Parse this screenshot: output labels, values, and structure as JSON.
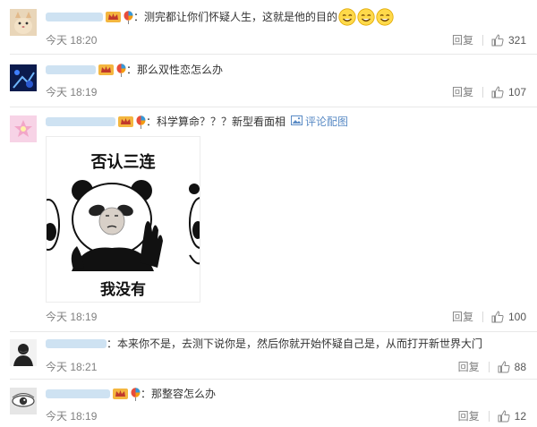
{
  "comments": [
    {
      "text": "：测完都让你们怀疑人生，这就是他的目的",
      "time": "今天 18:20",
      "reply": "回复",
      "likes": "321",
      "emoji_count": 3
    },
    {
      "text": "：那么双性恋怎么办",
      "time": "今天 18:19",
      "reply": "回复",
      "likes": "107"
    },
    {
      "text": "：科学算命？？？新型看面相",
      "link": "评论配图",
      "time": "今天 18:19",
      "reply": "回复",
      "likes": "100",
      "meme": {
        "top": "否认三连",
        "bottom": "我没有"
      }
    },
    {
      "text": "：本来你不是，去测下说你是，然后你就开始怀疑自己是，从而打开新世界大门",
      "time": "今天 18:21",
      "reply": "回复",
      "likes": "88"
    },
    {
      "text": "：那整容怎么办",
      "time": "今天 18:19",
      "reply": "回复",
      "likes": "12"
    }
  ],
  "icons": {
    "badge_vip": "crown-badge-icon",
    "badge_balloon": "balloon-badge-icon",
    "like": "thumbs-up-icon",
    "emoji": "smile-emoji-icon",
    "image_link": "image-icon"
  },
  "colors": {
    "link": "#5a8bc5",
    "meta": "#808080",
    "username_blur": "#c9dff1"
  }
}
